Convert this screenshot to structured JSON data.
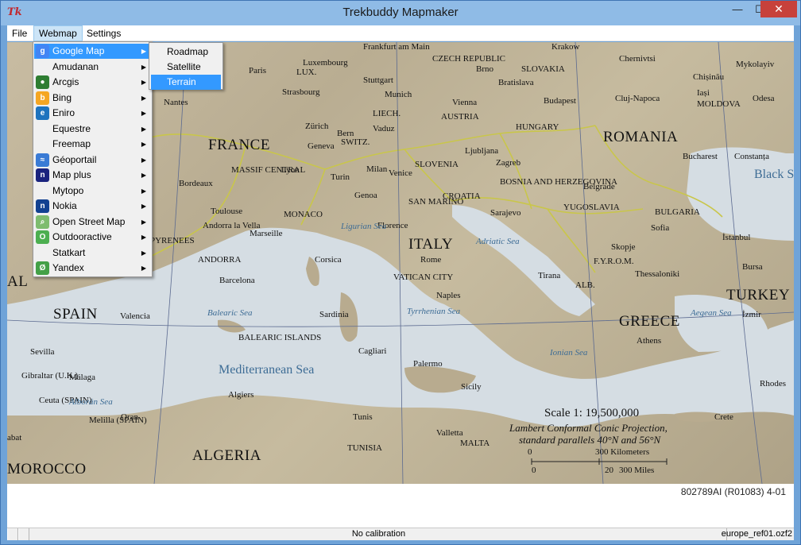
{
  "window": {
    "title": "Trekbuddy Mapmaker",
    "icon": "tk-icon",
    "minimize_glyph": "—",
    "maximize_glyph": "☐",
    "close_glyph": "✕"
  },
  "menubar": {
    "file": "File",
    "webmap": "Webmap",
    "settings": "Settings"
  },
  "webmap_menu": {
    "items": [
      {
        "label": "Google Map",
        "icon": "google-icon",
        "color": "#4285f4",
        "glyph": "g",
        "active": true
      },
      {
        "label": "Amudanan",
        "icon": "",
        "color": "",
        "glyph": ""
      },
      {
        "label": "Arcgis",
        "icon": "globe-icon",
        "color": "#2e7d32",
        "glyph": "●"
      },
      {
        "label": "Bing",
        "icon": "bing-icon",
        "color": "#f5a623",
        "glyph": "b"
      },
      {
        "label": "Eniro",
        "icon": "eniro-icon",
        "color": "#1e73be",
        "glyph": "e"
      },
      {
        "label": "Equestre",
        "icon": "",
        "color": "",
        "glyph": ""
      },
      {
        "label": "Freemap",
        "icon": "",
        "color": "",
        "glyph": ""
      },
      {
        "label": "Géoportail",
        "icon": "geoportail-icon",
        "color": "#3a7bd5",
        "glyph": "≈"
      },
      {
        "label": "Map plus",
        "icon": "mapplus-icon",
        "color": "#1a237e",
        "glyph": "n"
      },
      {
        "label": "Mytopo",
        "icon": "",
        "color": "",
        "glyph": ""
      },
      {
        "label": "Nokia",
        "icon": "nokia-icon",
        "color": "#124191",
        "glyph": "n"
      },
      {
        "label": "Open Street Map",
        "icon": "osm-icon",
        "color": "#7ebc6f",
        "glyph": "⌕"
      },
      {
        "label": "Outdooractive",
        "icon": "outdooractive-icon",
        "color": "#4caf50",
        "glyph": "O"
      },
      {
        "label": "Statkart",
        "icon": "",
        "color": "",
        "glyph": ""
      },
      {
        "label": "Yandex",
        "icon": "yandex-icon",
        "color": "#43a047",
        "glyph": "Ø"
      }
    ],
    "arrow": "▶"
  },
  "google_submenu": {
    "items": [
      {
        "label": "Roadmap"
      },
      {
        "label": "Satellite"
      },
      {
        "label": "Terrain",
        "active": true
      }
    ]
  },
  "map": {
    "labels": [
      {
        "text": "Paris",
        "cls": ""
      },
      {
        "text": "Luxembourg",
        "cls": ""
      },
      {
        "text": "Frankfurt am Main",
        "cls": ""
      },
      {
        "text": "CZECH REPUBLIC",
        "cls": ""
      },
      {
        "text": "Brno",
        "cls": ""
      },
      {
        "text": "SLOVAKIA",
        "cls": ""
      },
      {
        "text": "Krakow",
        "cls": ""
      },
      {
        "text": "Chernivtsi",
        "cls": ""
      },
      {
        "text": "Mykolayiv",
        "cls": ""
      },
      {
        "text": "Chișinău",
        "cls": ""
      },
      {
        "text": "Iași",
        "cls": ""
      },
      {
        "text": "MOLDOVA",
        "cls": ""
      },
      {
        "text": "Odesa",
        "cls": ""
      },
      {
        "text": "Stuttgart",
        "cls": ""
      },
      {
        "text": "Munich",
        "cls": ""
      },
      {
        "text": "Bratislava",
        "cls": ""
      },
      {
        "text": "Vienna",
        "cls": ""
      },
      {
        "text": "Budapest",
        "cls": ""
      },
      {
        "text": "Cluj-Napoca",
        "cls": ""
      },
      {
        "text": "Strasbourg",
        "cls": ""
      },
      {
        "text": "LUX.",
        "cls": ""
      },
      {
        "text": "Nantes",
        "cls": ""
      },
      {
        "text": "LIECH.",
        "cls": ""
      },
      {
        "text": "AUSTRIA",
        "cls": ""
      },
      {
        "text": "HUNGARY",
        "cls": ""
      },
      {
        "text": "ROMANIA",
        "cls": "country"
      },
      {
        "text": "Zürich",
        "cls": ""
      },
      {
        "text": "Bern",
        "cls": ""
      },
      {
        "text": "Vaduz",
        "cls": ""
      },
      {
        "text": "SWITZ.",
        "cls": ""
      },
      {
        "text": "Geneva",
        "cls": ""
      },
      {
        "text": "FRANCE",
        "cls": "country"
      },
      {
        "text": "Ljubljana",
        "cls": ""
      },
      {
        "text": "Zagreb",
        "cls": ""
      },
      {
        "text": "Bucharest",
        "cls": ""
      },
      {
        "text": "Constanța",
        "cls": ""
      },
      {
        "text": "Black Sea",
        "cls": "bigsea"
      },
      {
        "text": "MASSIF CENTRAL",
        "cls": ""
      },
      {
        "text": "Lyon",
        "cls": ""
      },
      {
        "text": "Milan",
        "cls": ""
      },
      {
        "text": "Venice",
        "cls": ""
      },
      {
        "text": "SLOVENIA",
        "cls": ""
      },
      {
        "text": "CROATIA",
        "cls": ""
      },
      {
        "text": "BOSNIA AND HERZEGOVINA",
        "cls": ""
      },
      {
        "text": "Belgrade",
        "cls": ""
      },
      {
        "text": "Bordeaux",
        "cls": ""
      },
      {
        "text": "Turin",
        "cls": ""
      },
      {
        "text": "Genoa",
        "cls": ""
      },
      {
        "text": "SAN MARINO",
        "cls": ""
      },
      {
        "text": "Sarajevo",
        "cls": ""
      },
      {
        "text": "YUGOSLAVIA",
        "cls": ""
      },
      {
        "text": "BULGARIA",
        "cls": ""
      },
      {
        "text": "Toulouse",
        "cls": ""
      },
      {
        "text": "MONACO",
        "cls": ""
      },
      {
        "text": "Florence",
        "cls": ""
      },
      {
        "text": "Sofia",
        "cls": ""
      },
      {
        "text": "Andorra la Vella",
        "cls": ""
      },
      {
        "text": "Marseille",
        "cls": ""
      },
      {
        "text": "Ligurian Sea",
        "cls": "sea"
      },
      {
        "text": "ITALY",
        "cls": "country"
      },
      {
        "text": "Adriatic Sea",
        "cls": "sea"
      },
      {
        "text": "Skopje",
        "cls": ""
      },
      {
        "text": "İstanbul",
        "cls": ""
      },
      {
        "text": "ANDORRA",
        "cls": ""
      },
      {
        "text": "Corsica",
        "cls": ""
      },
      {
        "text": "Rome",
        "cls": ""
      },
      {
        "text": "F.Y.R.O.M.",
        "cls": ""
      },
      {
        "text": "Bursa",
        "cls": ""
      },
      {
        "text": "Barcelona",
        "cls": ""
      },
      {
        "text": "VATICAN CITY",
        "cls": ""
      },
      {
        "text": "Tirana",
        "cls": ""
      },
      {
        "text": "ALB.",
        "cls": ""
      },
      {
        "text": "Thessaloniki",
        "cls": ""
      },
      {
        "text": "Naples",
        "cls": ""
      },
      {
        "text": "TURKEY",
        "cls": "country"
      },
      {
        "text": "SPAIN",
        "cls": "country"
      },
      {
        "text": "Valencia",
        "cls": ""
      },
      {
        "text": "Balearic Sea",
        "cls": "sea"
      },
      {
        "text": "Sardinia",
        "cls": ""
      },
      {
        "text": "Tyrrhenian Sea",
        "cls": "sea"
      },
      {
        "text": "GREECE",
        "cls": "country"
      },
      {
        "text": "Aegean Sea",
        "cls": "sea"
      },
      {
        "text": "İzmir",
        "cls": ""
      },
      {
        "text": "BALEARIC ISLANDS",
        "cls": ""
      },
      {
        "text": "Athens",
        "cls": ""
      },
      {
        "text": "Sevilla",
        "cls": ""
      },
      {
        "text": "Cagliari",
        "cls": ""
      },
      {
        "text": "Ionian Sea",
        "cls": "sea"
      },
      {
        "text": "Mediterranean Sea",
        "cls": "bigsea"
      },
      {
        "text": "Palermo",
        "cls": ""
      },
      {
        "text": "Rhodes",
        "cls": ""
      },
      {
        "text": "Gibraltar (U.K.)",
        "cls": ""
      },
      {
        "text": "Málaga",
        "cls": ""
      },
      {
        "text": "Sicily",
        "cls": ""
      },
      {
        "text": "Algiers",
        "cls": ""
      },
      {
        "text": "Ceuta (SPAIN)",
        "cls": ""
      },
      {
        "text": "Alborán Sea",
        "cls": "sea"
      },
      {
        "text": "Tunis",
        "cls": ""
      },
      {
        "text": "Scale 1: 19,500,000",
        "cls": "scale"
      },
      {
        "text": "Crete",
        "cls": ""
      },
      {
        "text": "Oran",
        "cls": ""
      },
      {
        "text": "Melilla (SPAIN)",
        "cls": ""
      },
      {
        "text": "Lambert Conformal Conic Projection,",
        "cls": "proj"
      },
      {
        "text": "standard parallels 40°N and 56°N",
        "cls": "proj"
      },
      {
        "text": "abat",
        "cls": ""
      },
      {
        "text": "Valletta",
        "cls": ""
      },
      {
        "text": "MALTA",
        "cls": ""
      },
      {
        "text": "TUNISIA",
        "cls": ""
      },
      {
        "text": "ALGERIA",
        "cls": "country"
      },
      {
        "text": "MOROCCO",
        "cls": "country"
      },
      {
        "text": "0",
        "cls": ""
      },
      {
        "text": "300 Kilometers",
        "cls": ""
      },
      {
        "text": "0",
        "cls": ""
      },
      {
        "text": "20",
        "cls": ""
      },
      {
        "text": "300 Miles",
        "cls": ""
      },
      {
        "text": "AL",
        "cls": "country"
      },
      {
        "text": "PYRENEES",
        "cls": ""
      }
    ]
  },
  "info": {
    "reference": "802789AI (R01083) 4-01"
  },
  "statusbar": {
    "calibration": "No calibration",
    "filename": "europe_ref01.ozf2"
  }
}
